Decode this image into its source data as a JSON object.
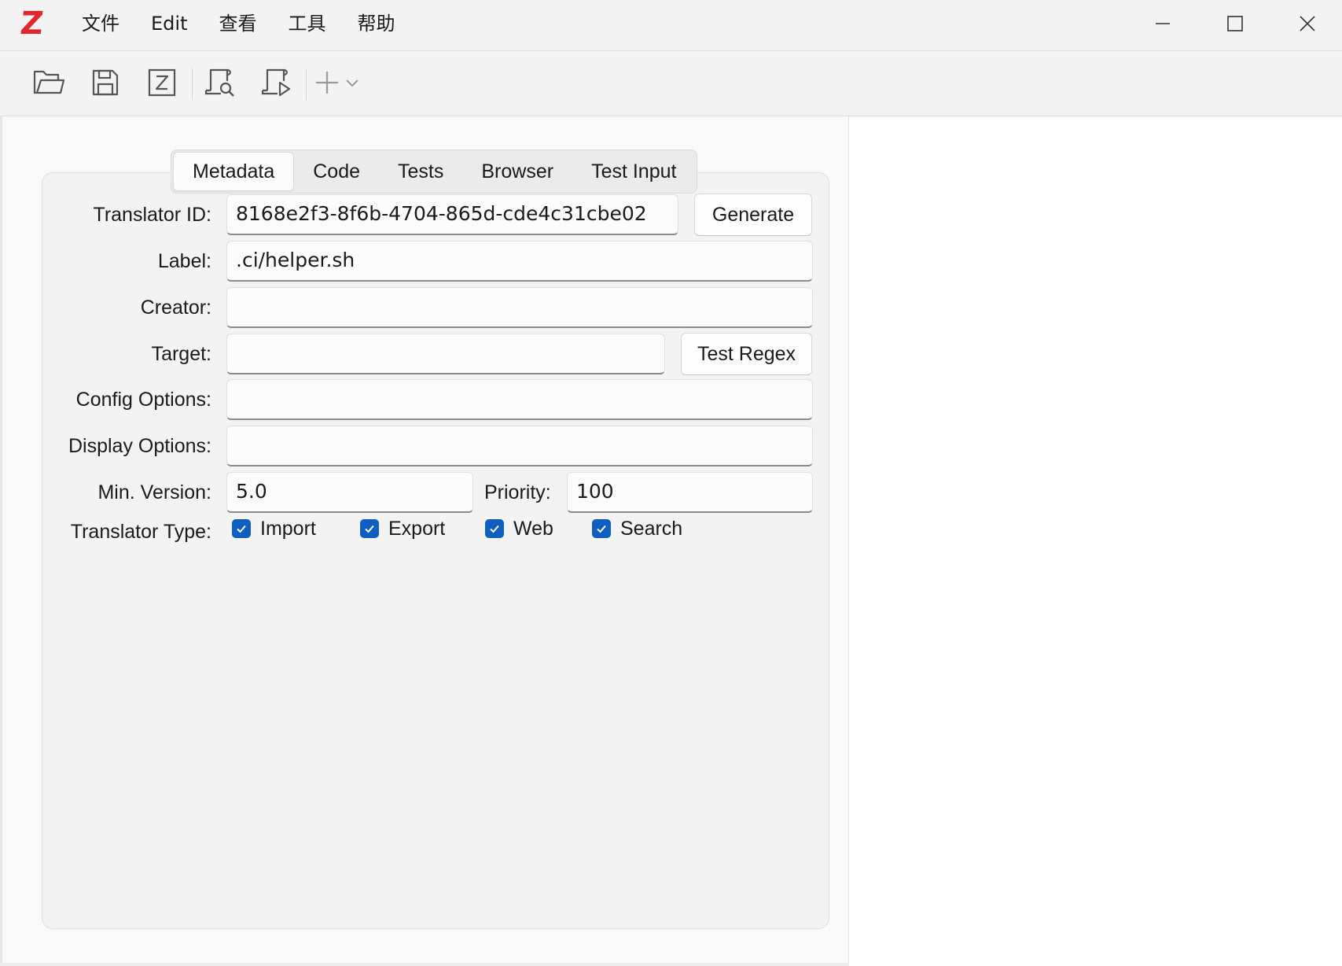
{
  "app": {
    "logo_letter": "Z",
    "logo_color": "#e0262e"
  },
  "menu": [
    "文件",
    "Edit",
    "查看",
    "工具",
    "帮助"
  ],
  "window_controls": {
    "minimize_icon": "minimize-icon",
    "maximize_icon": "maximize-icon",
    "close_icon": "close-icon"
  },
  "toolbar": {
    "icons": [
      "open-folder-icon",
      "save-icon",
      "zotero-icon",
      "detect-icon",
      "run-icon",
      "add-icon",
      "chevron-down-icon"
    ]
  },
  "tabs": [
    "Metadata",
    "Code",
    "Tests",
    "Browser",
    "Test Input"
  ],
  "active_tab": "Metadata",
  "form": {
    "translator_id_label": "Translator ID:",
    "translator_id_value": "8168e2f3-8f6b-4704-865d-cde4c31cbe02",
    "generate_button": "Generate",
    "label_label": "Label:",
    "label_value": ".ci/helper.sh",
    "creator_label": "Creator:",
    "creator_value": "",
    "target_label": "Target:",
    "target_value": "",
    "test_regex_button": "Test Regex",
    "config_options_label": "Config Options:",
    "config_options_value": "",
    "display_options_label": "Display Options:",
    "display_options_value": "",
    "min_version_label": "Min. Version:",
    "min_version_value": "5.0",
    "priority_label": "Priority:",
    "priority_value": "100",
    "translator_type_label": "Translator Type:",
    "types": [
      {
        "label": "Import",
        "checked": true
      },
      {
        "label": "Export",
        "checked": true
      },
      {
        "label": "Web",
        "checked": true
      },
      {
        "label": "Search",
        "checked": true
      }
    ]
  },
  "colors": {
    "accent": "#0f5fc0",
    "titlebar": "#f3f3f3"
  }
}
